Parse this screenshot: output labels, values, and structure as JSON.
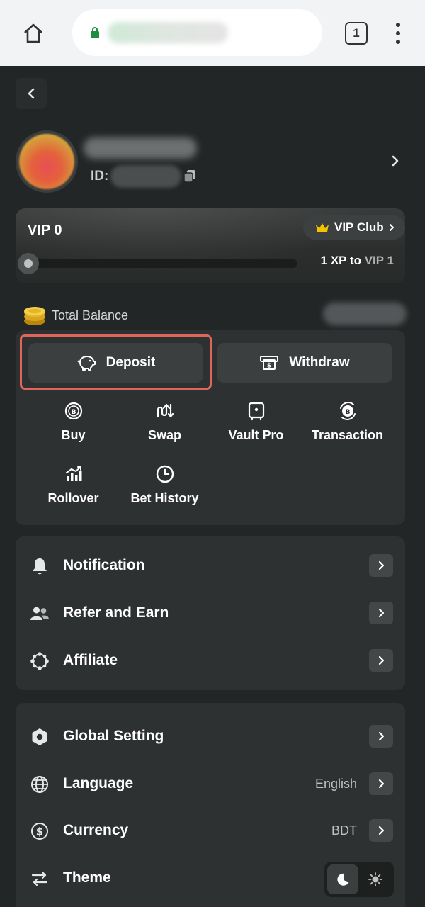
{
  "browser": {
    "tab_count": "1"
  },
  "profile": {
    "id_label": "ID:"
  },
  "vip": {
    "level": "VIP 0",
    "club_label": "VIP Club",
    "xp_text": "1 XP to",
    "next_level": "VIP 1",
    "progress": 0
  },
  "balance": {
    "label": "Total Balance"
  },
  "wallet": {
    "deposit_label": "Deposit",
    "withdraw_label": "Withdraw",
    "actions": [
      {
        "label": "Buy",
        "icon": "bitcoin-coin-icon"
      },
      {
        "label": "Swap",
        "icon": "swap-arrows-icon"
      },
      {
        "label": "Vault Pro",
        "icon": "vault-icon"
      },
      {
        "label": "Transaction",
        "icon": "transaction-coin-icon"
      },
      {
        "label": "Rollover",
        "icon": "rollover-chart-icon"
      },
      {
        "label": "Bet History",
        "icon": "clock-icon"
      }
    ]
  },
  "menu1": [
    {
      "label": "Notification",
      "icon": "bell-icon"
    },
    {
      "label": "Refer and Earn",
      "icon": "users-icon"
    },
    {
      "label": "Affiliate",
      "icon": "affiliate-ring-icon"
    }
  ],
  "menu2": [
    {
      "label": "Global Setting",
      "icon": "hexagon-settings-icon",
      "value": ""
    },
    {
      "label": "Language",
      "icon": "globe-icon",
      "value": "English"
    },
    {
      "label": "Currency",
      "icon": "dollar-circle-icon",
      "value": "BDT"
    },
    {
      "label": "Theme",
      "icon": "swap-horizontal-icon",
      "value": ""
    }
  ],
  "theme": {
    "selected": "dark"
  },
  "colors": {
    "background": "#232626",
    "panel": "#2e3131",
    "highlight": "#e0665d",
    "crown": "#f5c400"
  }
}
